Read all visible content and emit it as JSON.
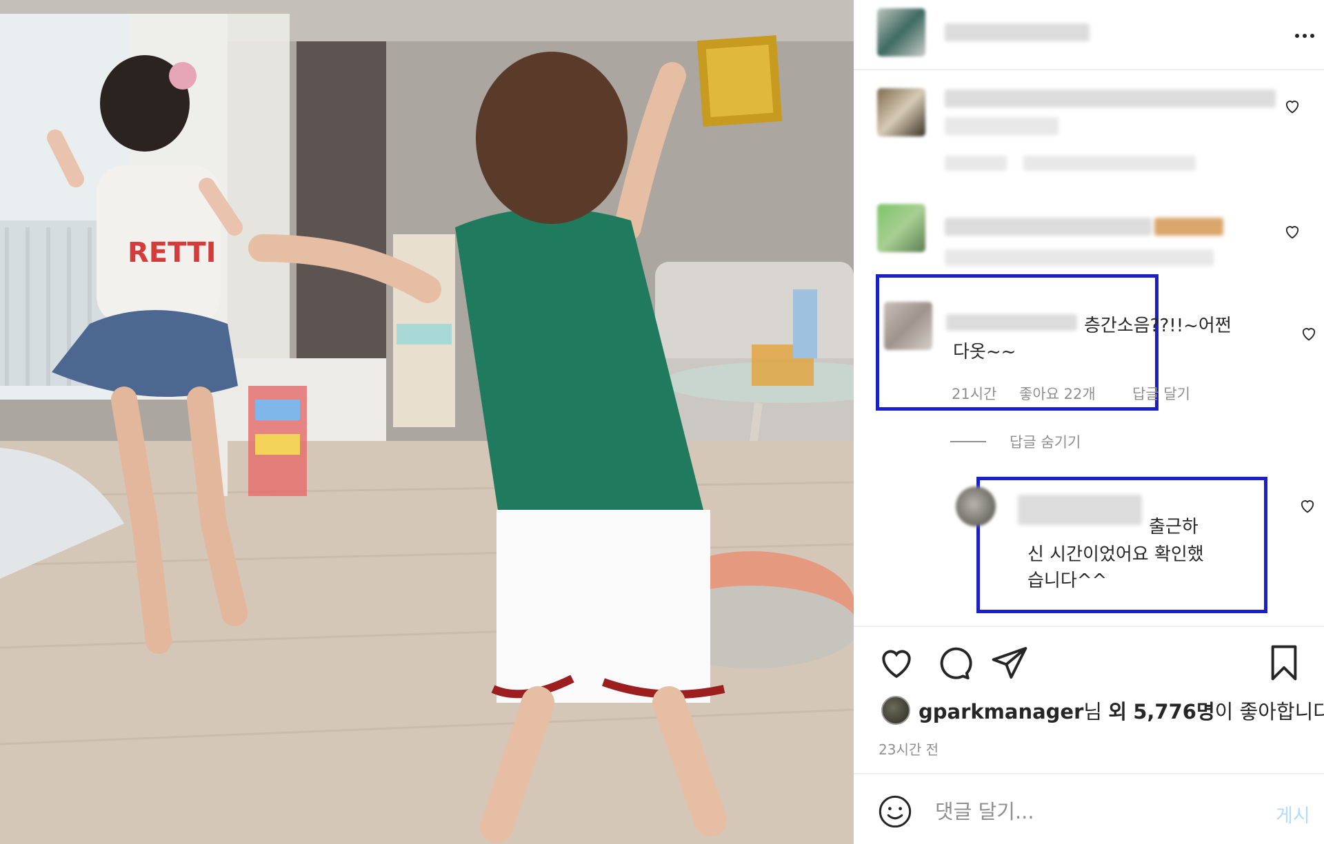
{
  "comments": {
    "c3": {
      "text_line1": "층간소음??!!~어쩐",
      "text_line2": "다옷~~",
      "time": "21시간",
      "likes": "좋아요 22개",
      "reply": "답글 달기"
    },
    "hide_replies": "답글 숨기기",
    "reply": {
      "line1": "출근하",
      "line2": "신 시간이었어요 확인했",
      "line3": "습니다^^"
    }
  },
  "likes": {
    "user": "gparkmanager",
    "suffix_nim": "님",
    "mid": "외",
    "count": "5,776명",
    "tail": "이 좋아합니다"
  },
  "time_ago": "23시간 전",
  "comment_box": {
    "placeholder": "댓글 달기...",
    "post_label": "게시"
  },
  "icons": {
    "more": "more-horizontal-icon",
    "heart": "heart-icon",
    "comment": "comment-icon",
    "share": "share-icon",
    "bookmark": "bookmark-icon",
    "emoji": "smile-icon"
  },
  "colors": {
    "highlight_box": "#1a20c8",
    "post_button": "#b3dbff",
    "meta_text": "#8e8e8e"
  }
}
